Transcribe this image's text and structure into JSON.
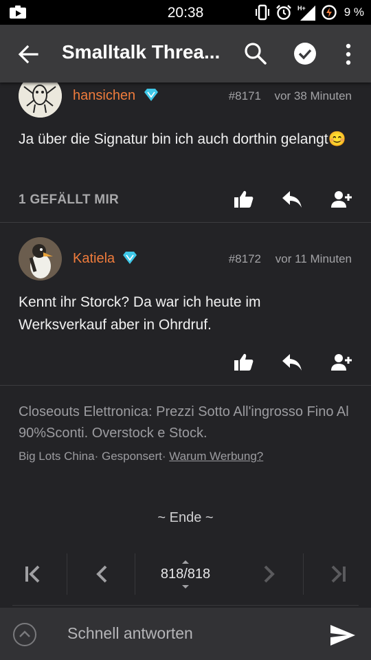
{
  "status": {
    "time": "20:38",
    "battery": "9 %",
    "network": "H+"
  },
  "app_bar": {
    "title": "Smalltalk Threa..."
  },
  "posts": [
    {
      "user": "hansichen",
      "number": "#8171",
      "time": "vor 38 Minuten",
      "body": "Ja über die Signatur bin ich auch dorthin gelangt",
      "emoji": "😊",
      "likes": "1 GEFÄLLT MIR"
    },
    {
      "user": "Katiela",
      "number": "#8172",
      "time": "vor 11 Minuten",
      "body": "Kennt ihr Storck? Da war ich heute im Werksverkauf aber in Ohrdruf."
    }
  ],
  "ad": {
    "title": "Closeouts Elettronica: Prezzi Sotto All'ingrosso Fino Al 90%Sconti. Overstock e Stock.",
    "source": "Big Lots China",
    "sponsored": "Gesponsert",
    "why": "Warum Werbung?"
  },
  "end_text": "~ Ende ~",
  "pager": {
    "current": "818",
    "total": "818"
  },
  "reply": {
    "placeholder": "Schnell antworten"
  },
  "colors": {
    "username": "#f07c3c",
    "verified": "#3fc8e8",
    "app_bar": "#3a3a3c",
    "background": "#232326"
  }
}
